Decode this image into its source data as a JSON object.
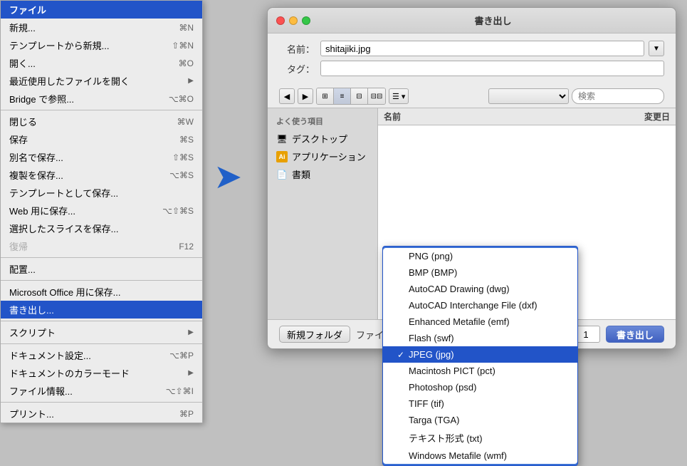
{
  "menu": {
    "title": "ファイル",
    "items": [
      {
        "label": "新規...",
        "shortcut": "⌘N",
        "type": "item"
      },
      {
        "label": "テンプレートから新規...",
        "shortcut": "⇧⌘N",
        "type": "item"
      },
      {
        "label": "開く...",
        "shortcut": "⌘O",
        "type": "item"
      },
      {
        "label": "最近使用したファイルを開く",
        "shortcut": "▶",
        "type": "item"
      },
      {
        "label": "Bridge で参照...",
        "shortcut": "⌥⌘O",
        "type": "item"
      },
      {
        "type": "separator"
      },
      {
        "label": "閉じる",
        "shortcut": "⌘W",
        "type": "item"
      },
      {
        "label": "保存",
        "shortcut": "⌘S",
        "type": "item"
      },
      {
        "label": "別名で保存...",
        "shortcut": "⇧⌘S",
        "type": "item"
      },
      {
        "label": "複製を保存...",
        "shortcut": "⌥⌘S",
        "type": "item"
      },
      {
        "label": "テンプレートとして保存...",
        "shortcut": "",
        "type": "item"
      },
      {
        "label": "Web 用に保存...",
        "shortcut": "⌥⇧⌘S",
        "type": "item"
      },
      {
        "label": "選択したスライスを保存...",
        "shortcut": "",
        "type": "item"
      },
      {
        "label": "復帰",
        "shortcut": "F12",
        "type": "item",
        "disabled": true
      },
      {
        "type": "separator"
      },
      {
        "label": "配置...",
        "shortcut": "",
        "type": "item"
      },
      {
        "type": "separator"
      },
      {
        "label": "Microsoft Office 用に保存...",
        "shortcut": "",
        "type": "item"
      },
      {
        "label": "書き出し...",
        "shortcut": "",
        "type": "item",
        "active": true
      },
      {
        "type": "separator"
      },
      {
        "label": "スクリプト",
        "shortcut": "▶",
        "type": "item"
      },
      {
        "type": "separator"
      },
      {
        "label": "ドキュメント設定...",
        "shortcut": "⌥⌘P",
        "type": "item"
      },
      {
        "label": "ドキュメントのカラーモード",
        "shortcut": "▶",
        "type": "item"
      },
      {
        "label": "ファイル情報...",
        "shortcut": "⌥⇧⌘I",
        "type": "item"
      },
      {
        "type": "separator"
      },
      {
        "label": "プリント...",
        "shortcut": "⌘P",
        "type": "item"
      }
    ]
  },
  "dialog": {
    "title": "書き出し",
    "filename_label": "名前：",
    "filename_value": "shitajiki.jpg",
    "tag_label": "タグ：",
    "sidebar": {
      "section_label": "よく使う項目",
      "items": [
        {
          "label": "デスクトップ",
          "icon": "🖥"
        },
        {
          "label": "アプリケーション",
          "icon": "Ai"
        },
        {
          "label": "書類",
          "icon": "📄"
        }
      ]
    },
    "file_list": {
      "col_name": "名前",
      "col_date": "変更日"
    },
    "bottom": {
      "format_label": "ファイル形式",
      "format_value": "JPEG (jpg)",
      "num_label": "1",
      "new_folder_label": "新規フォルダ",
      "export_label": "書き出し"
    },
    "dropdown": {
      "items": [
        {
          "label": "PNG (png)",
          "selected": false
        },
        {
          "label": "BMP (BMP)",
          "selected": false
        },
        {
          "label": "AutoCAD Drawing (dwg)",
          "selected": false
        },
        {
          "label": "AutoCAD Interchange File (dxf)",
          "selected": false
        },
        {
          "label": "Enhanced Metafile (emf)",
          "selected": false
        },
        {
          "label": "Flash (swf)",
          "selected": false
        },
        {
          "label": "JPEG (jpg)",
          "selected": true
        },
        {
          "label": "Macintosh PICT (pct)",
          "selected": false
        },
        {
          "label": "Photoshop (psd)",
          "selected": false
        },
        {
          "label": "TIFF (tif)",
          "selected": false
        },
        {
          "label": "Targa (TGA)",
          "selected": false
        },
        {
          "label": "テキスト形式 (txt)",
          "selected": false
        },
        {
          "label": "Windows Metafile (wmf)",
          "selected": false
        }
      ]
    }
  }
}
